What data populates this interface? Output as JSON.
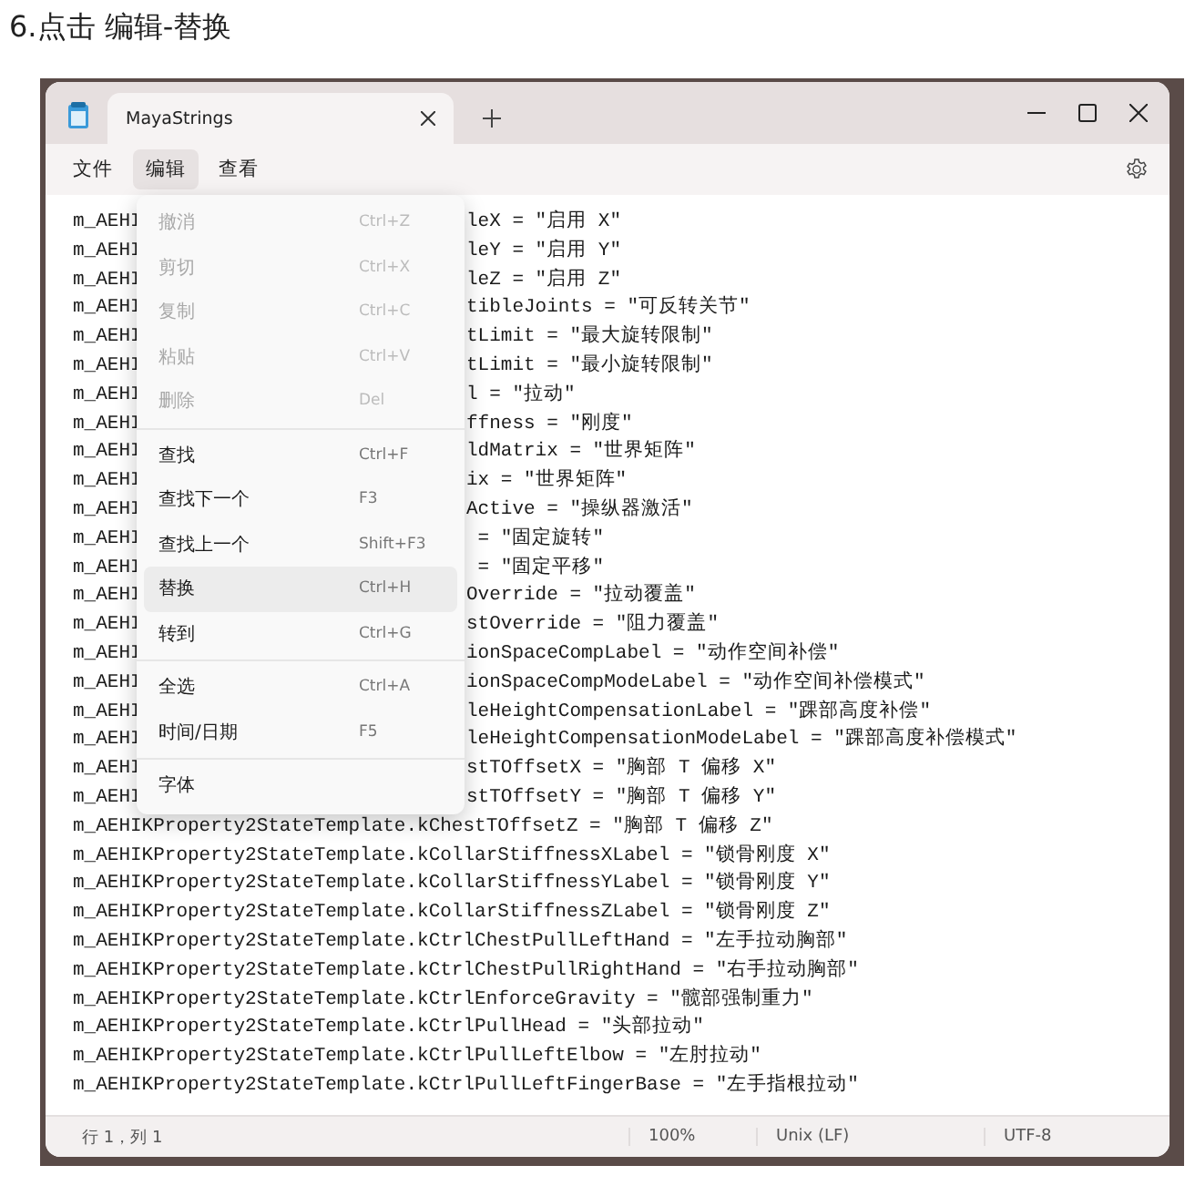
{
  "heading": "6.点击 编辑-替换",
  "window": {
    "tab_title": "MayaStrings"
  },
  "menu_bar": [
    {
      "label": "文件",
      "selected": false
    },
    {
      "label": "编辑",
      "selected": true
    },
    {
      "label": "查看",
      "selected": false
    }
  ],
  "edit_menu": [
    {
      "kind": "item",
      "label": "撤消",
      "shortcut": "Ctrl+Z",
      "disabled": true,
      "selected": false
    },
    {
      "kind": "item",
      "label": "剪切",
      "shortcut": "Ctrl+X",
      "disabled": true,
      "selected": false
    },
    {
      "kind": "item",
      "label": "复制",
      "shortcut": "Ctrl+C",
      "disabled": true,
      "selected": false
    },
    {
      "kind": "item",
      "label": "粘贴",
      "shortcut": "Ctrl+V",
      "disabled": true,
      "selected": false
    },
    {
      "kind": "item",
      "label": "删除",
      "shortcut": "Del",
      "disabled": true,
      "selected": false
    },
    {
      "kind": "divider"
    },
    {
      "kind": "item",
      "label": "查找",
      "shortcut": "Ctrl+F",
      "disabled": false,
      "selected": false
    },
    {
      "kind": "item",
      "label": "查找下一个",
      "shortcut": "F3",
      "disabled": false,
      "selected": false
    },
    {
      "kind": "item",
      "label": "查找上一个",
      "shortcut": "Shift+F3",
      "disabled": false,
      "selected": false
    },
    {
      "kind": "item",
      "label": "替换",
      "shortcut": "Ctrl+H",
      "disabled": false,
      "selected": true
    },
    {
      "kind": "item",
      "label": "转到",
      "shortcut": "Ctrl+G",
      "disabled": false,
      "selected": false
    },
    {
      "kind": "divider"
    },
    {
      "kind": "item",
      "label": "全选",
      "shortcut": "Ctrl+A",
      "disabled": false,
      "selected": false
    },
    {
      "kind": "item",
      "label": "时间/日期",
      "shortcut": "F5",
      "disabled": false,
      "selected": false
    },
    {
      "kind": "divider"
    },
    {
      "kind": "item",
      "label": "字体",
      "disabled": false,
      "selected": false
    }
  ],
  "code_lines": [
    {
      "kind": "covered",
      "left": "m_AEHI",
      "right": "leX = \"启用 X\""
    },
    {
      "kind": "covered",
      "left": "m_AEHI",
      "right": "leY = \"启用 Y\""
    },
    {
      "kind": "covered",
      "left": "m_AEHI",
      "right": "leZ = \"启用 Z\""
    },
    {
      "kind": "covered",
      "left": "m_AEHI",
      "right": "tibleJoints = \"可反转关节\""
    },
    {
      "kind": "covered",
      "left": "m_AEHI",
      "right": "tLimit = \"最大旋转限制\""
    },
    {
      "kind": "covered",
      "left": "m_AEHI",
      "right": "tLimit = \"最小旋转限制\""
    },
    {
      "kind": "covered",
      "left": "m_AEHI",
      "right": "l = \"拉动\""
    },
    {
      "kind": "covered",
      "left": "m_AEHI",
      "right": "ffness = \"刚度\""
    },
    {
      "kind": "covered",
      "left": "m_AEHI",
      "right": "ldMatrix = \"世界矩阵\""
    },
    {
      "kind": "covered",
      "left": "m_AEHI",
      "right": "ix = \"世界矩阵\""
    },
    {
      "kind": "covered",
      "left": "m_AEHI",
      "right": "Active = \"操纵器激活\""
    },
    {
      "kind": "covered",
      "left": "m_AEHI",
      "right": " = \"固定旋转\""
    },
    {
      "kind": "covered",
      "left": "m_AEHI",
      "right": " = \"固定平移\""
    },
    {
      "kind": "covered",
      "left": "m_AEHI",
      "right": "Override = \"拉动覆盖\""
    },
    {
      "kind": "covered",
      "left": "m_AEHI",
      "right": "stOverride = \"阻力覆盖\""
    },
    {
      "kind": "covered",
      "left": "m_AEHI",
      "right": "ionSpaceCompLabel = \"动作空间补偿\""
    },
    {
      "kind": "covered",
      "left": "m_AEHI",
      "right": "ionSpaceCompModeLabel = \"动作空间补偿模式\""
    },
    {
      "kind": "covered",
      "left": "m_AEHI",
      "right": "leHeightCompensationLabel = \"踝部高度补偿\""
    },
    {
      "kind": "covered",
      "left": "m_AEHI",
      "right": "leHeightCompensationModeLabel = \"踝部高度补偿模式\""
    },
    {
      "kind": "covered",
      "left": "m_AEHI",
      "right": "stTOffsetX = \"胸部 T 偏移 X\""
    },
    {
      "kind": "covered",
      "left": "m_AEHI",
      "right": "stTOffsetY = \"胸部 T 偏移 Y\""
    },
    {
      "kind": "full",
      "text": "m_AEHIKProperty2StateTemplate.kChestTOffsetZ = \"胸部 T 偏移 Z\""
    },
    {
      "kind": "full",
      "text": "m_AEHIKProperty2StateTemplate.kCollarStiffnessXLabel = \"锁骨刚度 X\""
    },
    {
      "kind": "full",
      "text": "m_AEHIKProperty2StateTemplate.kCollarStiffnessYLabel = \"锁骨刚度 Y\""
    },
    {
      "kind": "full",
      "text": "m_AEHIKProperty2StateTemplate.kCollarStiffnessZLabel = \"锁骨刚度 Z\""
    },
    {
      "kind": "full",
      "text": "m_AEHIKProperty2StateTemplate.kCtrlChestPullLeftHand = \"左手拉动胸部\""
    },
    {
      "kind": "full",
      "text": "m_AEHIKProperty2StateTemplate.kCtrlChestPullRightHand = \"右手拉动胸部\""
    },
    {
      "kind": "full",
      "text": "m_AEHIKProperty2StateTemplate.kCtrlEnforceGravity = \"髋部强制重力\""
    },
    {
      "kind": "full",
      "text": "m_AEHIKProperty2StateTemplate.kCtrlPullHead = \"头部拉动\""
    },
    {
      "kind": "full",
      "text": "m_AEHIKProperty2StateTemplate.kCtrlPullLeftElbow = \"左肘拉动\""
    },
    {
      "kind": "full",
      "text": "m_AEHIKProperty2StateTemplate.kCtrlPullLeftFingerBase = \"左手指根拉动\""
    }
  ],
  "status_bar": {
    "position": "行 1，列 1",
    "zoom": "100%",
    "line_ending": "Unix (LF)",
    "encoding": "UTF-8"
  }
}
